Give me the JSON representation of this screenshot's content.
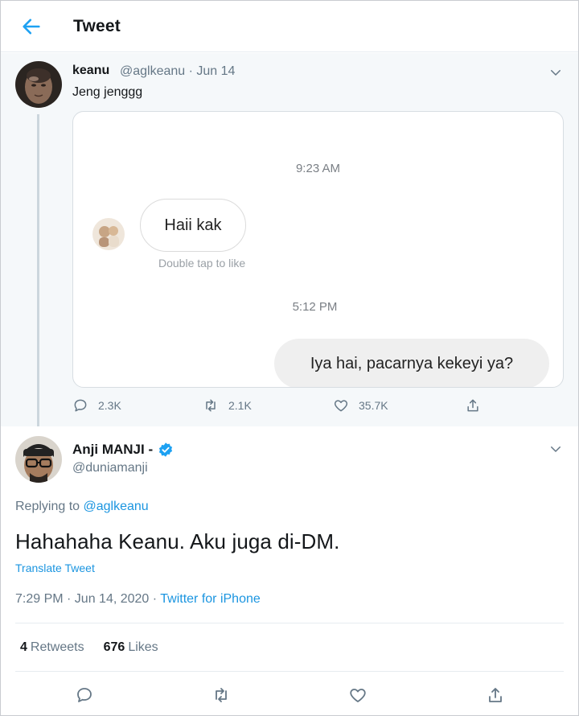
{
  "header": {
    "title": "Tweet",
    "back_icon": "arrow-left-icon",
    "accent": "#1da1f2"
  },
  "parent_tweet": {
    "name": "keanu",
    "handle_date": "@aglkeanu · Jun 14",
    "text": "Jeng jenggg",
    "screenshot": {
      "time_1": "9:23 AM",
      "incoming_message": "Haii kak",
      "hint": "Double tap to like",
      "time_2": "5:12 PM",
      "outgoing_message": "Iya hai, pacarnya kekeyi ya?"
    },
    "actions": {
      "replies": "2.3K",
      "retweets": "2.1K",
      "likes": "35.7K"
    }
  },
  "reply_tweet": {
    "name": "Anji MANJI -",
    "handle": "@duniamanji",
    "replying_prefix": "Replying to",
    "replying_to": "@aglkeanu",
    "text": "Hahahaha Keanu. Aku juga di-DM.",
    "translate": "Translate Tweet",
    "timestamp": "7:29 PM · Jun 14, 2020 · ",
    "via": "Twitter for iPhone",
    "retweets_count": "4",
    "retweets_label": "Retweets",
    "likes_count": "676",
    "likes_label": "Likes"
  },
  "colors": {
    "link": "#1b95e0",
    "muted": "#657786",
    "verified": "#1da1f2"
  }
}
